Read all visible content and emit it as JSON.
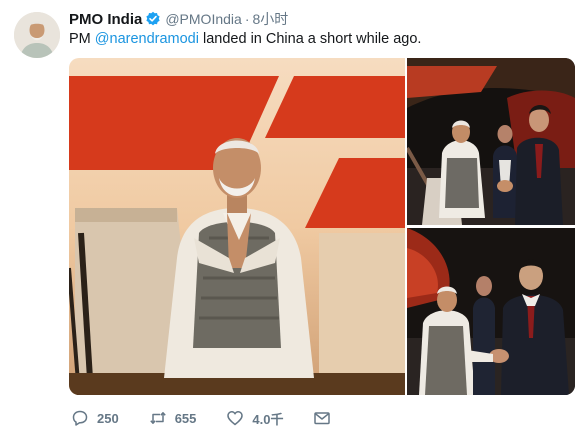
{
  "user": {
    "display_name": "PMO India",
    "handle": "@PMOIndia",
    "separator": "·",
    "time": "8小时",
    "verified_icon": "verified-badge-icon",
    "avatar_icon": "profile-avatar"
  },
  "tweet": {
    "prefix": "PM ",
    "mention": "@narendramodi",
    "suffix": " landed in China a short while ago."
  },
  "actions": {
    "reply_count": "250",
    "retweet_count": "655",
    "like_count": "4.0千",
    "icons": [
      "reply-icon",
      "retweet-icon",
      "like-icon",
      "direct-message-icon"
    ]
  },
  "colors": {
    "link": "#1b95e0",
    "verified": "#1da1f2",
    "meta_text": "#657786",
    "aircraft_red": "#d63a1c"
  }
}
